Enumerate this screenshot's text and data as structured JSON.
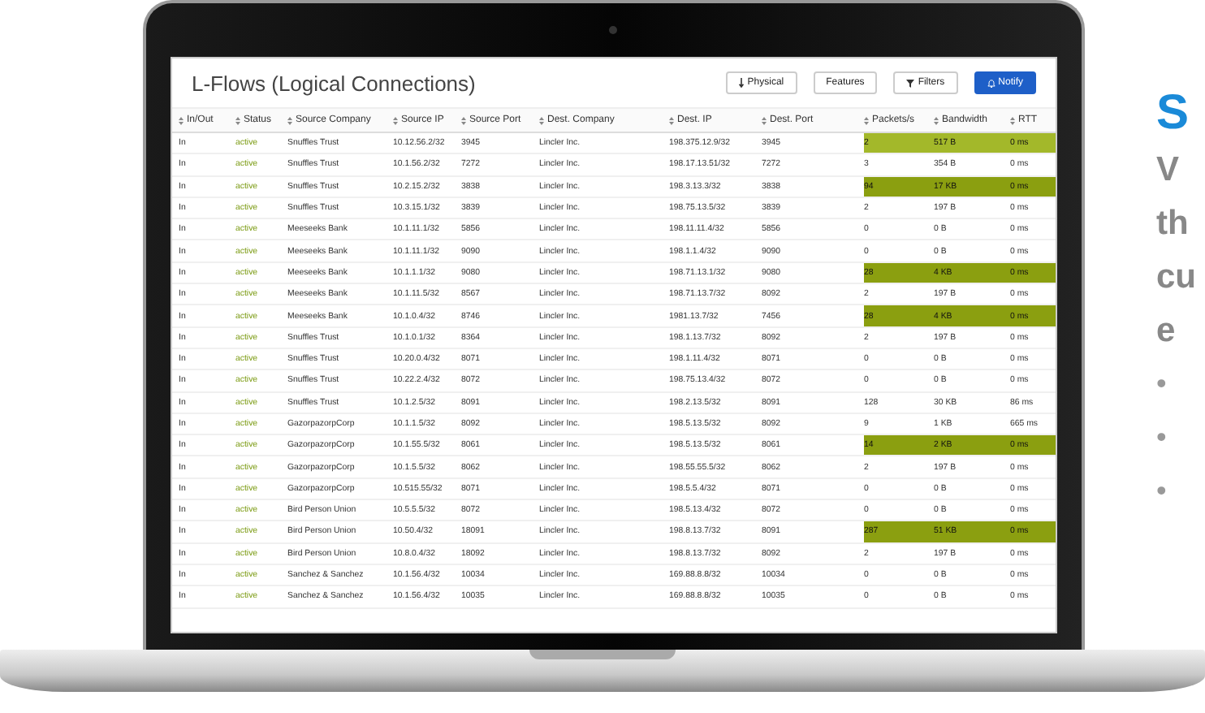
{
  "app": {
    "title": "L-Flows (Logical Connections)",
    "buttons": [
      {
        "label": "Physical",
        "kind": "arrow",
        "primary": false
      },
      {
        "label": "Features",
        "kind": "plain",
        "primary": false
      },
      {
        "label": "Filters",
        "kind": "funnel",
        "primary": false
      },
      {
        "label": "Notify",
        "kind": "bell",
        "primary": true
      }
    ]
  },
  "table": {
    "columns": [
      "In/Out",
      "Status",
      "Source Company",
      "Source IP",
      "Source Port",
      "Dest. Company",
      "Dest. IP",
      "Dest. Port",
      "Packets/s",
      "Bandwidth",
      "RTT"
    ],
    "rows": [
      {
        "color": "#a3b82a",
        "cells": [
          "In",
          "active",
          "Snuffles Trust",
          "10.12.56.2/32",
          "3945",
          "Lincler Inc.",
          "198.375.12.9/32",
          "3945",
          "2",
          "517 B",
          "0 ms"
        ]
      },
      {
        "cells": [
          "In",
          "active",
          "Snuffles Trust",
          "10.1.56.2/32",
          "7272",
          "Lincler Inc.",
          "198.17.13.51/32",
          "7272",
          "3",
          "354 B",
          "0 ms"
        ]
      },
      {
        "color": "#8b9f10",
        "cells": [
          "In",
          "active",
          "Snuffles Trust",
          "10.2.15.2/32",
          "3838",
          "Lincler Inc.",
          "198.3.13.3/32",
          "3838",
          "94",
          "17 KB",
          "0 ms"
        ]
      },
      {
        "cells": [
          "In",
          "active",
          "Snuffles Trust",
          "10.3.15.1/32",
          "3839",
          "Lincler Inc.",
          "198.75.13.5/32",
          "3839",
          "2",
          "197 B",
          "0 ms"
        ]
      },
      {
        "cells": [
          "In",
          "active",
          "Meeseeks Bank",
          "10.1.11.1/32",
          "5856",
          "Lincler Inc.",
          "198.11.11.4/32",
          "5856",
          "0",
          "0 B",
          "0 ms"
        ]
      },
      {
        "cells": [
          "In",
          "active",
          "Meeseeks Bank",
          "10.1.11.1/32",
          "9090",
          "Lincler Inc.",
          "198.1.1.4/32",
          "9090",
          "0",
          "0 B",
          "0 ms"
        ]
      },
      {
        "color": "#8b9f10",
        "cells": [
          "In",
          "active",
          "Meeseeks Bank",
          "10.1.1.1/32",
          "9080",
          "Lincler Inc.",
          "198.71.13.1/32",
          "9080",
          "28",
          "4 KB",
          "0 ms"
        ]
      },
      {
        "cells": [
          "In",
          "active",
          "Meeseeks Bank",
          "10.1.11.5/32",
          "8567",
          "Lincler Inc.",
          "198.71.13.7/32",
          "8092",
          "2",
          "197 B",
          "0 ms"
        ]
      },
      {
        "color": "#8b9f10",
        "cells": [
          "In",
          "active",
          "Meeseeks Bank",
          "10.1.0.4/32",
          "8746",
          "Lincler Inc.",
          "1981.13.7/32",
          "7456",
          "28",
          "4 KB",
          "0 ms"
        ]
      },
      {
        "cells": [
          "In",
          "active",
          "Snuffles Trust",
          "10.1.0.1/32",
          "8364",
          "Lincler Inc.",
          "198.1.13.7/32",
          "8092",
          "2",
          "197 B",
          "0 ms"
        ]
      },
      {
        "cells": [
          "In",
          "active",
          "Snuffles Trust",
          "10.20.0.4/32",
          "8071",
          "Lincler Inc.",
          "198.1.11.4/32",
          "8071",
          "0",
          "0 B",
          "0 ms"
        ]
      },
      {
        "cells": [
          "In",
          "active",
          "Snuffles Trust",
          "10.22.2.4/32",
          "8072",
          "Lincler Inc.",
          "198.75.13.4/32",
          "8072",
          "0",
          "0 B",
          "0 ms"
        ]
      },
      {
        "cells": [
          "In",
          "active",
          "Snuffles Trust",
          "10.1.2.5/32",
          "8091",
          "Lincler Inc.",
          "198.2.13.5/32",
          "8091",
          "128",
          "30 KB",
          "86 ms"
        ]
      },
      {
        "cells": [
          "In",
          "active",
          "GazorpazorpCorp",
          "10.1.1.5/32",
          "8092",
          "Lincler Inc.",
          "198.5.13.5/32",
          "8092",
          "9",
          "1 KB",
          "665 ms"
        ]
      },
      {
        "color": "#8b9f10",
        "cells": [
          "In",
          "active",
          "GazorpazorpCorp",
          "10.1.55.5/32",
          "8061",
          "Lincler Inc.",
          "198.5.13.5/32",
          "8061",
          "14",
          "2 KB",
          "0 ms"
        ]
      },
      {
        "cells": [
          "In",
          "active",
          "GazorpazorpCorp",
          "10.1.5.5/32",
          "8062",
          "Lincler Inc.",
          "198.55.55.5/32",
          "8062",
          "2",
          "197 B",
          "0 ms"
        ]
      },
      {
        "cells": [
          "In",
          "active",
          "GazorpazorpCorp",
          "10.515.55/32",
          "8071",
          "Lincler Inc.",
          "198.5.5.4/32",
          "8071",
          "0",
          "0 B",
          "0 ms"
        ]
      },
      {
        "cells": [
          "In",
          "active",
          "Bird Person Union",
          "10.5.5.5/32",
          "8072",
          "Lincler Inc.",
          "198.5.13.4/32",
          "8072",
          "0",
          "0 B",
          "0 ms"
        ]
      },
      {
        "color": "#8b9f10",
        "cells": [
          "In",
          "active",
          "Bird Person Union",
          "10.50.4/32",
          "18091",
          "Lincler Inc.",
          "198.8.13.7/32",
          "8091",
          "287",
          "51 KB",
          "0 ms"
        ]
      },
      {
        "cells": [
          "In",
          "active",
          "Bird Person Union",
          "10.8.0.4/32",
          "18092",
          "Lincler Inc.",
          "198.8.13.7/32",
          "8092",
          "2",
          "197 B",
          "0 ms"
        ]
      },
      {
        "cells": [
          "In",
          "active",
          "Sanchez & Sanchez",
          "10.1.56.4/32",
          "10034",
          "Lincler Inc.",
          "169.88.8.8/32",
          "10034",
          "0",
          "0 B",
          "0 ms"
        ]
      },
      {
        "cells": [
          "In",
          "active",
          "Sanchez & Sanchez",
          "10.1.56.4/32",
          "10035",
          "Lincler Inc.",
          "169.88.8.8/32",
          "10035",
          "0",
          "0 B",
          "0 ms"
        ]
      }
    ]
  },
  "side_text": {
    "heading": "S",
    "lines": [
      "V",
      "th",
      "cu",
      "e"
    ],
    "bullets": [
      "•",
      "•",
      "•"
    ]
  }
}
